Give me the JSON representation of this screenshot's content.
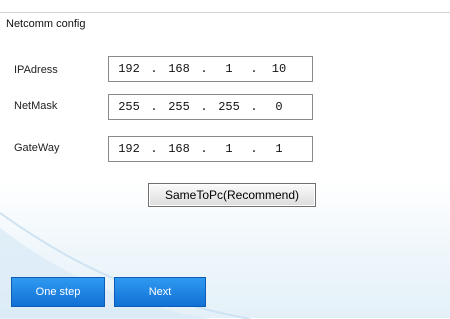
{
  "panel": {
    "title": "Netcomm config"
  },
  "fields": {
    "ip": {
      "label": "IPAdress",
      "octets": [
        "192",
        "168",
        "1",
        "10"
      ]
    },
    "mask": {
      "label": "NetMask",
      "octets": [
        "255",
        "255",
        "255",
        "0"
      ]
    },
    "gateway": {
      "label": "GateWay",
      "octets": [
        "192",
        "168",
        "1",
        "1"
      ]
    }
  },
  "buttons": {
    "same_to_pc": "SameToPc(Recommend)",
    "one_step": "One step",
    "next": "Next"
  },
  "colors": {
    "accent_button": "#1a7ee0",
    "background_tint": "#e4f0f8"
  }
}
